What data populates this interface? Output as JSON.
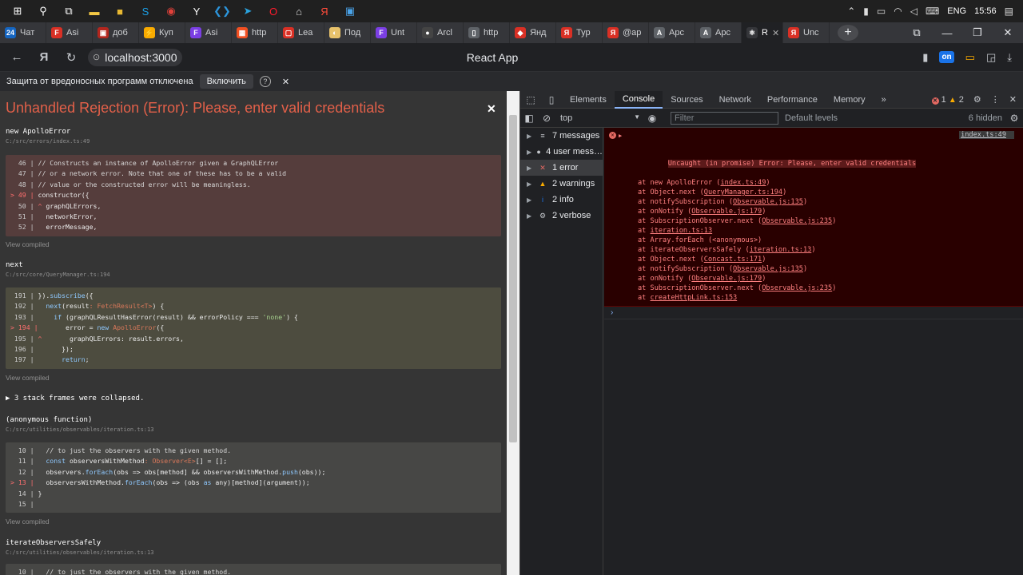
{
  "taskbar": {
    "icons": [
      {
        "name": "windows-start-icon",
        "glyph": "⊞",
        "color": "#ffffff"
      },
      {
        "name": "search-icon",
        "glyph": "⚲",
        "color": "#ffffff"
      },
      {
        "name": "task-view-icon",
        "glyph": "⧉",
        "color": "#ffffff"
      },
      {
        "name": "file-explorer-icon",
        "glyph": "▬",
        "color": "#f2c744"
      },
      {
        "name": "sticky-notes-icon",
        "glyph": "■",
        "color": "#e8b832"
      },
      {
        "name": "skype-icon",
        "glyph": "S",
        "color": "#1aa0e8"
      },
      {
        "name": "chrome-icon",
        "glyph": "◉",
        "color": "#e0413a"
      },
      {
        "name": "yandex-browser-icon",
        "glyph": "Y",
        "color": "#ffffff"
      },
      {
        "name": "vscode-icon",
        "glyph": "❮❯",
        "color": "#2c95dc"
      },
      {
        "name": "telegram-icon",
        "glyph": "➤",
        "color": "#2aa3de"
      },
      {
        "name": "opera-icon",
        "glyph": "O",
        "color": "#ff1b2d"
      },
      {
        "name": "lock-app-icon",
        "glyph": "⌂",
        "color": "#dddddd"
      },
      {
        "name": "yandex-icon",
        "glyph": "Я",
        "color": "#ff4b3a"
      },
      {
        "name": "photos-icon",
        "glyph": "▣",
        "color": "#4aa3e8"
      }
    ],
    "tray": {
      "language": "ENG",
      "time": "15:56"
    }
  },
  "tabs": [
    {
      "label": "Чат",
      "fav": "24",
      "color": "#1565c0"
    },
    {
      "label": "Asi",
      "fav": "F",
      "color": "#d93025"
    },
    {
      "label": "доб",
      "fav": "▣",
      "color": "#b3261e"
    },
    {
      "label": "Куп",
      "fav": "⚡",
      "color": "#f9ab00"
    },
    {
      "label": "Asi",
      "fav": "F",
      "color": "#7b3fe4"
    },
    {
      "label": "http",
      "fav": "▦",
      "color": "#f25022"
    },
    {
      "label": "Lea",
      "fav": "▢",
      "color": "#d93025"
    },
    {
      "label": "Под",
      "fav": "◐",
      "color": "#e8c26b"
    },
    {
      "label": "Unt",
      "fav": "F",
      "color": "#7b3fe4"
    },
    {
      "label": "Arcl",
      "fav": "●",
      "color": "#444444"
    },
    {
      "label": "http",
      "fav": "▯",
      "color": "#5f6368"
    },
    {
      "label": "Янд",
      "fav": "◆",
      "color": "#d93025"
    },
    {
      "label": "Тур",
      "fav": "Я",
      "color": "#d93025"
    },
    {
      "label": "@ар",
      "fav": "Я",
      "color": "#d93025"
    },
    {
      "label": "Apc",
      "fav": "A",
      "color": "#5f6368"
    },
    {
      "label": "Apc",
      "fav": "A",
      "color": "#5f6368"
    },
    {
      "label": "R",
      "fav": "⚛",
      "color": "#35363a",
      "active": true
    },
    {
      "label": "Unc",
      "fav": "Я",
      "color": "#d93025"
    }
  ],
  "address": {
    "url": "localhost:3000",
    "page_title": "React App",
    "extension_badge": "on"
  },
  "notification": {
    "text": "Защита от вредоносных программ отключена",
    "button": "Включить",
    "help": "?",
    "close": "✕"
  },
  "overlay": {
    "title": "Unhandled Rejection (Error): Please, enter valid credentials",
    "close": "✕",
    "view_compiled": "View compiled",
    "collapsed_text": "▶ 3 stack frames were collapsed.",
    "frames": [
      {
        "name": "new ApolloError",
        "path": "C:/src/errors/index.ts:49"
      },
      {
        "name": "next",
        "path": "C:/src/core/QueryManager.ts:194"
      },
      {
        "name": "(anonymous function)",
        "path": "C:/src/utilities/observables/iteration.ts:13"
      },
      {
        "name": "iterateObserversSafely",
        "path": "C:/src/utilities/observables/iteration.ts:13"
      }
    ]
  },
  "devtools": {
    "tabs": [
      "Elements",
      "Console",
      "Sources",
      "Network",
      "Performance",
      "Memory"
    ],
    "more": "»",
    "error_count": "1",
    "warning_count": "2",
    "context": "top",
    "filter_placeholder": "Filter",
    "levels": "Default levels",
    "hidden": "6 hidden",
    "sidebar": [
      {
        "label": "7 messages",
        "icon": "≡",
        "color": "#c4c7cc",
        "icon_name": "list-icon"
      },
      {
        "label": "4 user mess…",
        "icon": "●",
        "color": "#c4c7cc",
        "icon_name": "user-icon"
      },
      {
        "label": "1 error",
        "icon": "✕",
        "color": "#e46962",
        "icon_name": "error-icon",
        "active": true
      },
      {
        "label": "2 warnings",
        "icon": "▲",
        "color": "#f9ab00",
        "icon_name": "warning-icon"
      },
      {
        "label": "2 info",
        "icon": "i",
        "color": "#1a73e8",
        "icon_name": "info-icon"
      },
      {
        "label": "2 verbose",
        "icon": "⚙",
        "color": "#c4c7cc",
        "icon_name": "verbose-icon"
      }
    ],
    "error": {
      "message": "Uncaught (in promise) Error: Please, enter valid credentials",
      "source": "index.ts:49",
      "stack": [
        {
          "fn": "at new ApolloError (",
          "link": "index.ts:49",
          "end": ")"
        },
        {
          "fn": "at Object.next (",
          "link": "QueryManager.ts:194",
          "end": ")"
        },
        {
          "fn": "at notifySubscription (",
          "link": "Observable.js:135",
          "end": ")"
        },
        {
          "fn": "at onNotify (",
          "link": "Observable.js:179",
          "end": ")"
        },
        {
          "fn": "at SubscriptionObserver.next (",
          "link": "Observable.js:235",
          "end": ")"
        },
        {
          "fn": "at ",
          "link": "iteration.ts:13",
          "end": ""
        },
        {
          "fn": "at Array.forEach (<anonymous>)",
          "link": "",
          "end": ""
        },
        {
          "fn": "at iterateObserversSafely (",
          "link": "iteration.ts:13",
          "end": ")"
        },
        {
          "fn": "at Object.next (",
          "link": "Concast.ts:171",
          "end": ")"
        },
        {
          "fn": "at notifySubscription (",
          "link": "Observable.js:135",
          "end": ")"
        },
        {
          "fn": "at onNotify (",
          "link": "Observable.js:179",
          "end": ")"
        },
        {
          "fn": "at SubscriptionObserver.next (",
          "link": "Observable.js:235",
          "end": ")"
        },
        {
          "fn": "at ",
          "link": "createHttpLink.ts:153",
          "end": ""
        }
      ]
    },
    "prompt": "›"
  }
}
